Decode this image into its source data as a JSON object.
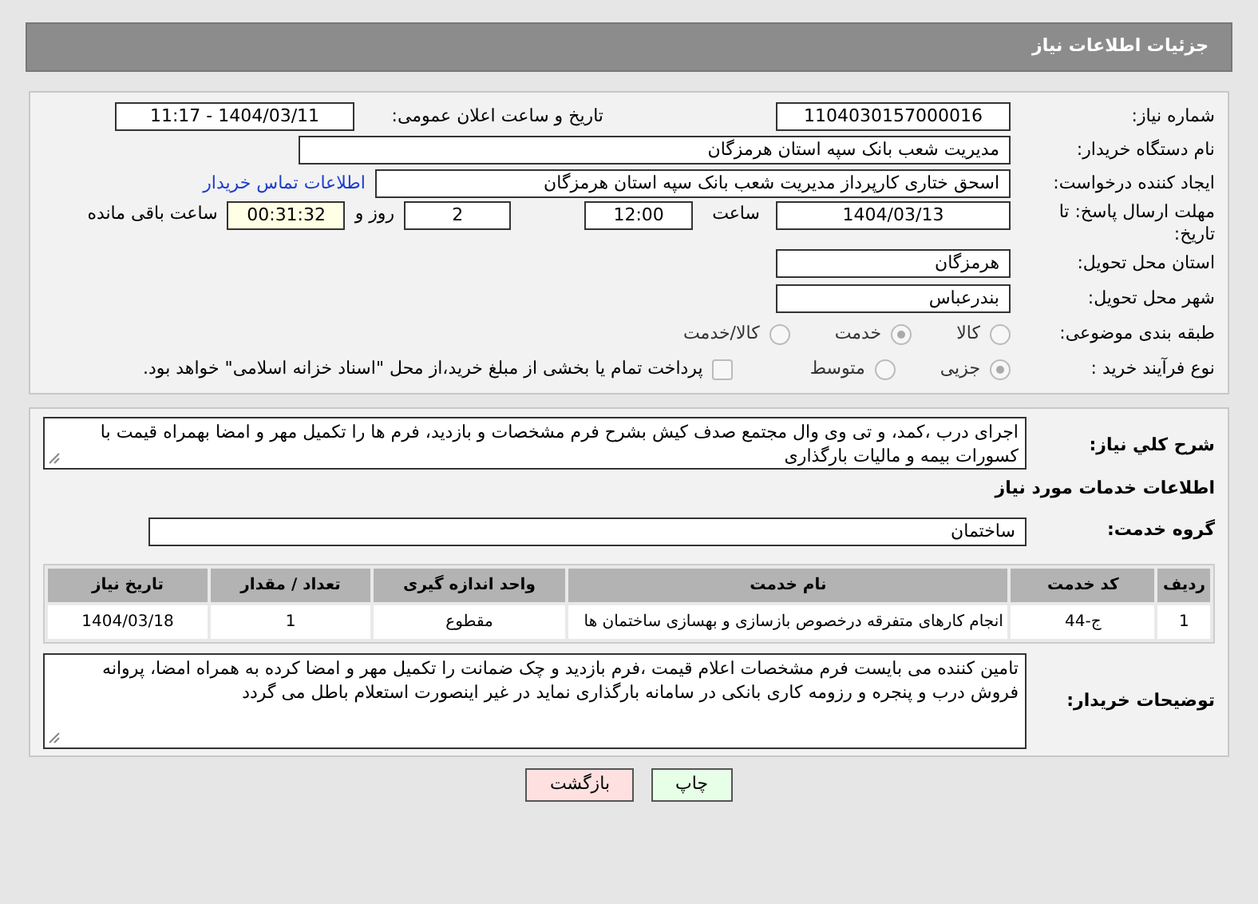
{
  "header": {
    "title": "جزئیات اطلاعات نیاز"
  },
  "details": {
    "need_number": {
      "label": "شماره نیاز:",
      "value": "1104030157000016"
    },
    "announce": {
      "label": "تاریخ و ساعت اعلان عمومی:",
      "value": "1404/03/11 - 11:17"
    },
    "buyer_org": {
      "label": "نام دستگاه خریدار:",
      "value": "مدیریت شعب بانک سپه استان هرمزگان"
    },
    "creator": {
      "label": "ایجاد کننده درخواست:",
      "value": "اسحق ختاری کارپرداز مدیریت شعب بانک سپه استان هرمزگان",
      "link": "اطلاعات تماس خریدار"
    },
    "deadline": {
      "label": "مهلت ارسال پاسخ: تا تاریخ:",
      "date": "1404/03/13",
      "time_label": "ساعت",
      "time": "12:00",
      "days": "2",
      "days_label": "روز و",
      "remaining": "00:31:32",
      "remaining_label": "ساعت باقی مانده"
    },
    "province": {
      "label": "استان محل تحویل:",
      "value": "هرمزگان"
    },
    "city": {
      "label": "شهر محل تحویل:",
      "value": "بندرعباس"
    },
    "category": {
      "label": "طبقه بندی موضوعی:",
      "options": [
        {
          "label": "کالا",
          "selected": false
        },
        {
          "label": "خدمت",
          "selected": true
        },
        {
          "label": "کالا/خدمت",
          "selected": false
        }
      ]
    },
    "process": {
      "label": "نوع فرآیند خرید :",
      "options": [
        {
          "label": "جزیی",
          "selected": true
        },
        {
          "label": "متوسط",
          "selected": false
        }
      ],
      "payment": {
        "checked": false,
        "text": "پرداخت تمام یا بخشی از مبلغ خرید،از محل \"اسناد خزانه اسلامی\" خواهد بود."
      }
    }
  },
  "description": {
    "label": "شرح کلي نياز:",
    "text": "اجرای درب ،کمد، و تی وی وال  مجتمع صدف کیش بشرح فرم مشخصات و بازدید، فرم ها را  تکمیل مهر و امضا بهمراه قیمت با کسورات بیمه و مالیات بارگذاری"
  },
  "services": {
    "title": "اطلاعات خدمات مورد نیاز",
    "group": {
      "label": "گروه خدمت:",
      "value": "ساختمان"
    },
    "table": {
      "columns": [
        "ردیف",
        "کد خدمت",
        "نام خدمت",
        "واحد اندازه گیری",
        "تعداد / مقدار",
        "تاریخ نیاز"
      ],
      "rows": [
        [
          "1",
          "ج-44",
          "انجام کارهای متفرقه درخصوص بازسازی و بهسازی ساختمان ها",
          "مقطوع",
          "1",
          "1404/03/18"
        ]
      ]
    }
  },
  "buyer_notes": {
    "label": "توضیحات خریدار:",
    "text": "تامین کننده می بایست  فرم مشخصات اعلام قیمت ،فرم بازدید و چک ضمانت را تکمیل مهر و امضا کرده به همراه امضا، پروانه فروش درب و پنجره  و رزومه کاری بانکی در سامانه بارگذاری نماید در غیر اینصورت استعلام باطل می گردد"
  },
  "buttons": [
    {
      "label": "چاپ",
      "kind": "print"
    },
    {
      "label": "بازگشت",
      "kind": "back"
    }
  ]
}
